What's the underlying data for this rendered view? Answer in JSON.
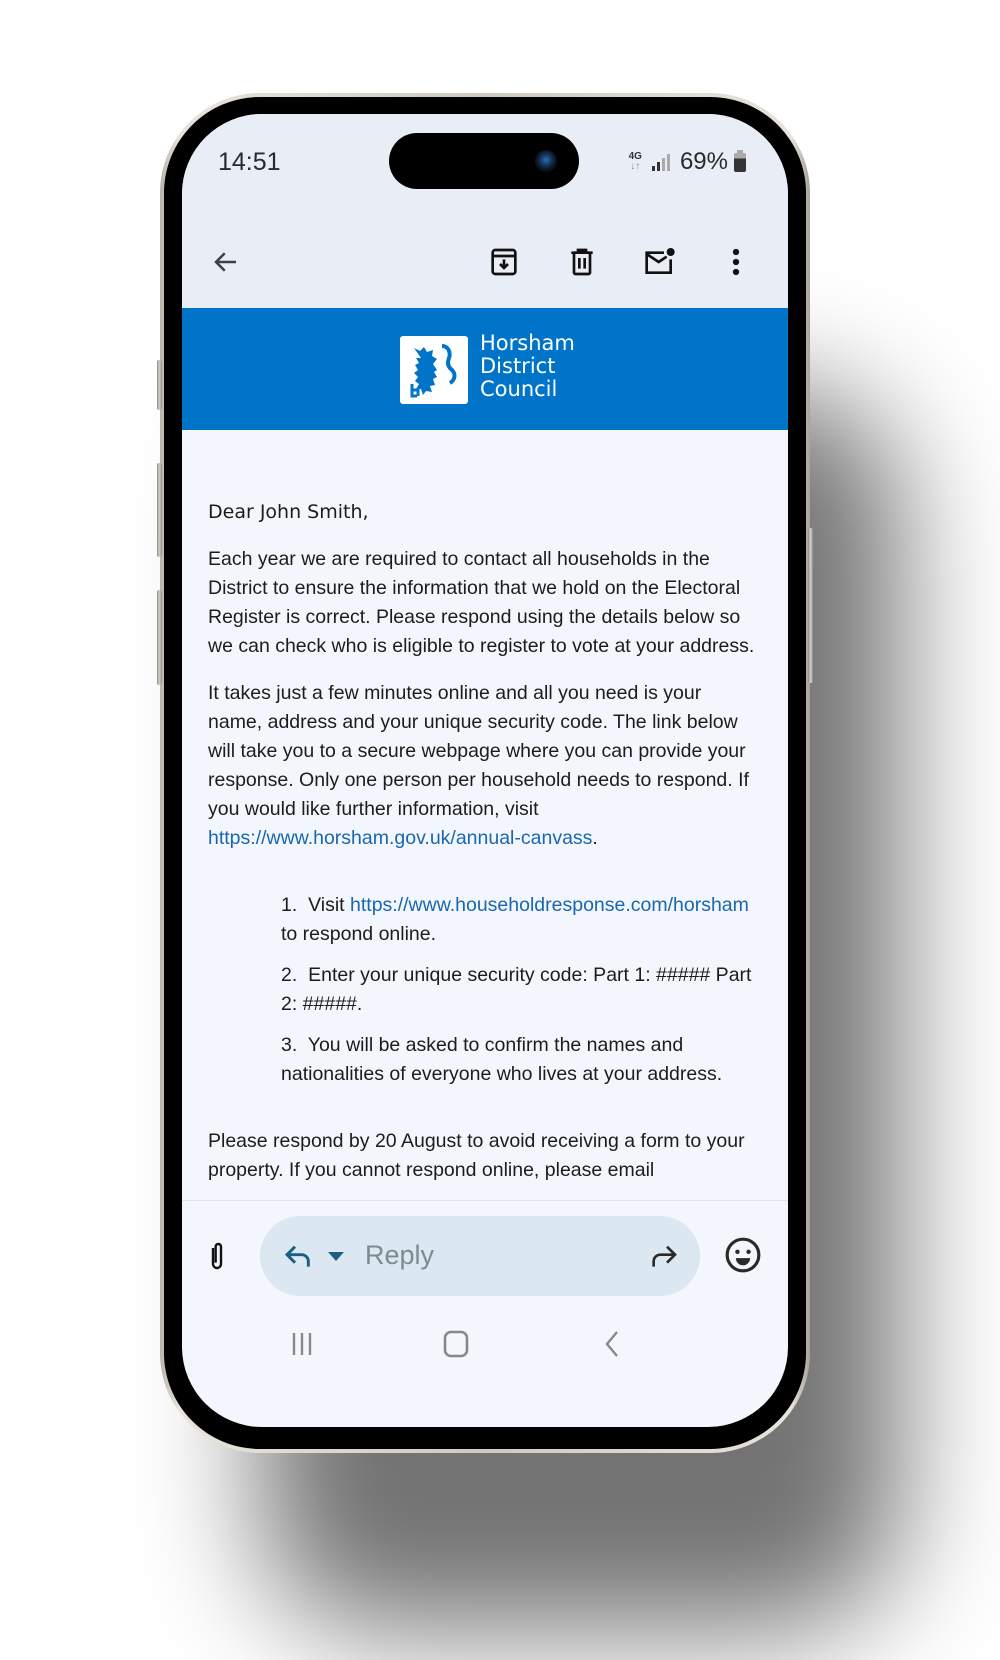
{
  "status_bar": {
    "time": "14:51",
    "network": "4G",
    "network_arrows": "↓↑",
    "battery_percent": "69%",
    "battery_level": 0.69
  },
  "toolbar": {
    "back": "back-arrow-icon",
    "actions": [
      "archive-icon",
      "delete-icon",
      "mark-unread-icon",
      "more-options-icon"
    ]
  },
  "banner": {
    "brand_color": "#0074c8",
    "org_line1": "Horsham",
    "org_line2": "District",
    "org_line3": "Council"
  },
  "email": {
    "greeting": "Dear John Smith,",
    "para1": "Each year we are required to contact all households in the District to ensure the information that we hold on the Electoral Register is correct. Please respond using the details below so we can check who is eligible to register to vote at your address.",
    "para2": "It takes just a few minutes online and all you need is your name, address and your unique security code. The link below will take you to a secure webpage where you can provide your response. Only one person per household needs to respond. If you would like further information, visit ",
    "para2_link": "https://www.horsham.gov.uk/annual-canvass",
    "para2_end": ".",
    "steps": [
      {
        "num": "1.",
        "pre": "Visit ",
        "link": "https://www.householdresponse.com/horsham",
        "post": " to respond online."
      },
      {
        "num": "2.",
        "text": "Enter your unique security code: Part 1: ##### Part 2: #####."
      },
      {
        "num": "3.",
        "text": "You will be asked to confirm the names and nationalities of everyone who lives at your address."
      }
    ],
    "para3": "Please respond by 20 August to avoid receiving a form to your property. If you cannot respond online, please email",
    "link_color": "#1a66b0"
  },
  "reply_bar": {
    "reply_placeholder": "Reply"
  },
  "nav_bar": {
    "buttons": [
      "recent-apps-icon",
      "home-icon",
      "back-icon"
    ]
  }
}
